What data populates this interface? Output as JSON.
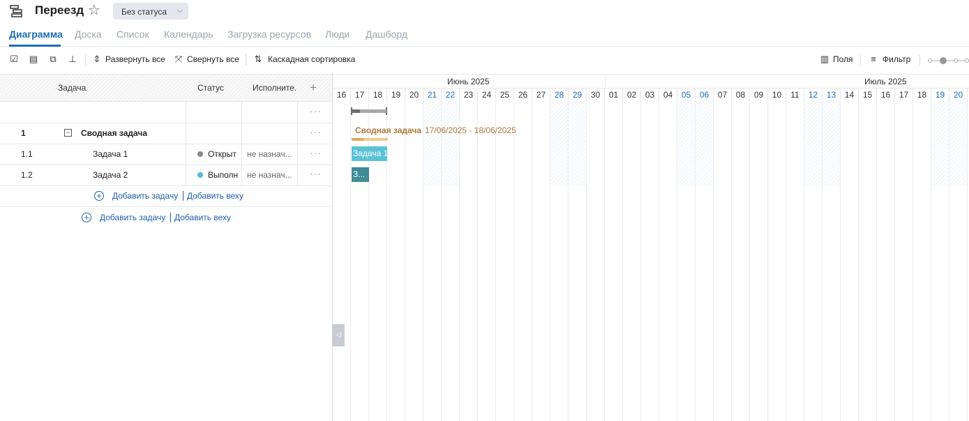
{
  "header": {
    "title": "Переезд",
    "status_value": "Без статуса",
    "icons": {
      "app": "gantt-app-icon",
      "favorite": "star-icon",
      "dropdown": "chevron-down-icon"
    }
  },
  "tabs": [
    {
      "label": "Диаграмма",
      "active": true
    },
    {
      "label": "Доска"
    },
    {
      "label": "Список"
    },
    {
      "label": "Календарь"
    },
    {
      "label": "Загрузка ресурсов"
    },
    {
      "label": "Люди"
    },
    {
      "label": "Дашборд"
    }
  ],
  "toolbar": {
    "expand_all": "Развернуть все",
    "collapse_all": "Свернуть все",
    "cascade_sort": "Каскадная сортировка",
    "fields": "Поля",
    "filter": "Фильтр"
  },
  "grid": {
    "columns": {
      "task": "Задача",
      "status": "Статус",
      "assignee": "Исполните..."
    },
    "rows": [
      {
        "num": "1",
        "name": "Сводная задача",
        "status": "",
        "assignee": "",
        "bold": true
      },
      {
        "num": "1.1",
        "name": "Задача 1",
        "status": "Открыт",
        "status_color": "#8a8a8a",
        "assignee": "не назнач..."
      },
      {
        "num": "1.2",
        "name": "Задача 2",
        "status": "Выполн",
        "status_color": "#4fbcd0",
        "assignee": "не назнач..."
      }
    ],
    "add_task": "Добавить задачу",
    "add_milestone": "Добавить веху"
  },
  "gantt": {
    "months": [
      "Июнь 2025",
      "Июль 2025"
    ],
    "days": [
      "16",
      "17",
      "18",
      "19",
      "20",
      "21",
      "22",
      "23",
      "24",
      "25",
      "26",
      "27",
      "28",
      "29",
      "30",
      "01",
      "02",
      "03",
      "04",
      "05",
      "06",
      "07",
      "08",
      "09",
      "10",
      "11",
      "12",
      "13",
      "14",
      "15",
      "16",
      "17",
      "18",
      "19",
      "20"
    ],
    "weekend_days_index": [
      5,
      6,
      12,
      13,
      19,
      20,
      26,
      27,
      33,
      34
    ],
    "summary_label": "Сводная задача",
    "summary_dates": "17/06/2025 - 18/06/2025",
    "task1_label": "Задача 1",
    "task2_label": "З...",
    "colors": {
      "summary_text": "#b07a3a",
      "task1": "#5bc2d6",
      "task2": "#3f8b96"
    }
  }
}
